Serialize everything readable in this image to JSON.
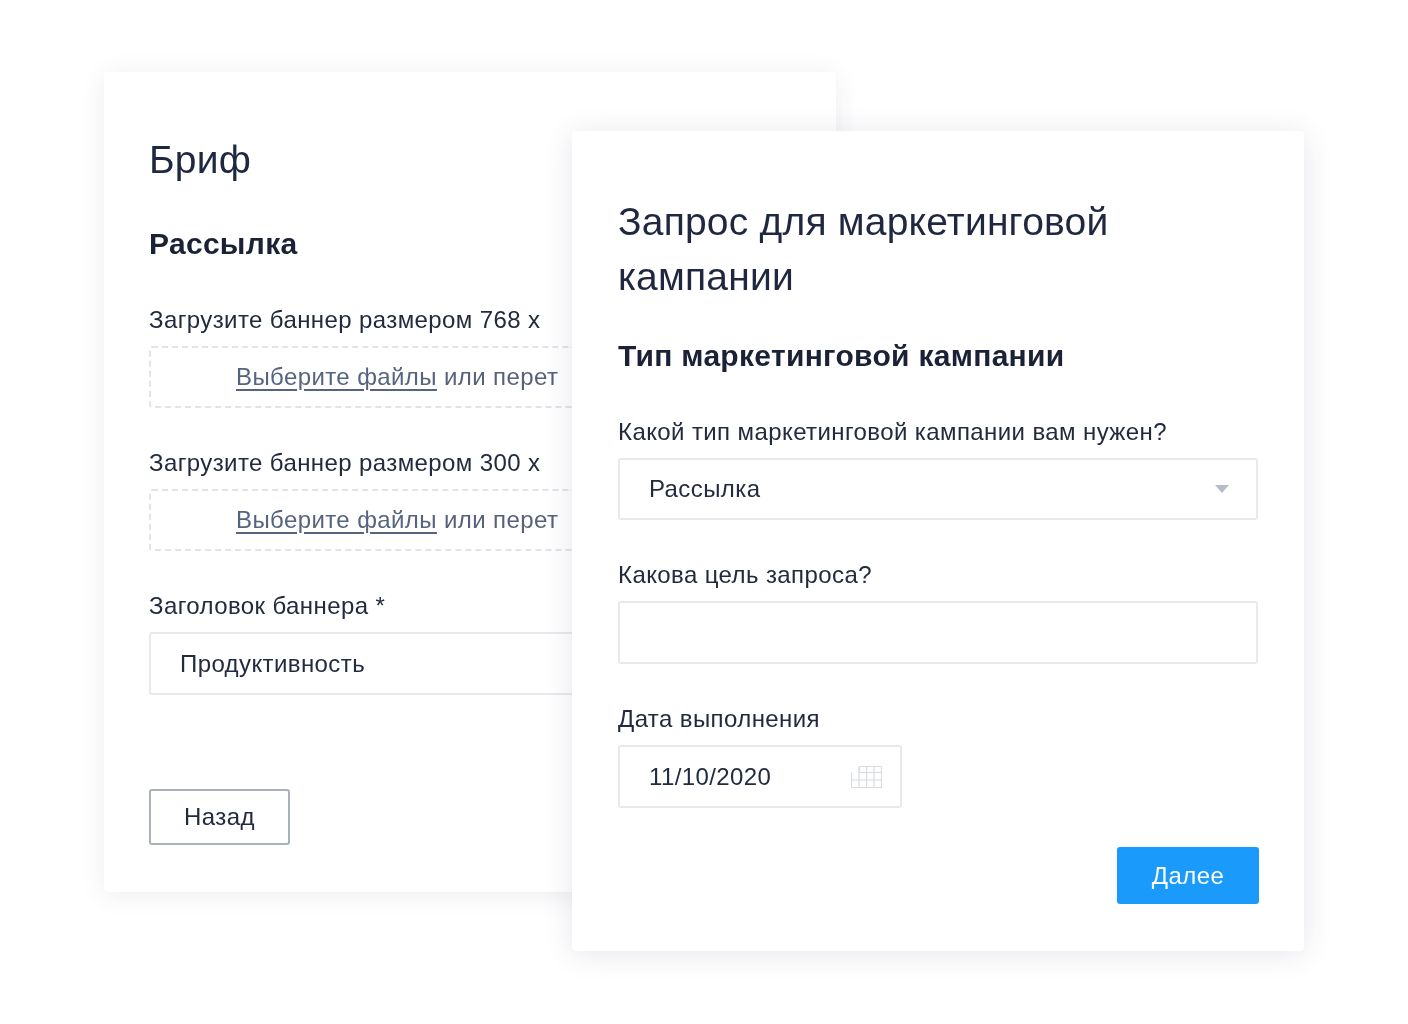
{
  "brief_card": {
    "title": "Бриф",
    "section": "Рассылка",
    "uploads": [
      {
        "label": "Загрузите баннер размером 768 x",
        "link": "Выберите файлы",
        "hint": "или перет"
      },
      {
        "label": "Загрузите баннер размером 300 x",
        "link": "Выберите файлы",
        "hint": "или перет"
      }
    ],
    "headline_field": {
      "label": "Заголовок баннера *",
      "value": "Продуктивность"
    },
    "back_button": "Назад"
  },
  "request_card": {
    "title": "Запрос для маркетинговой кампании",
    "section": "Тип маркетинговой кампании",
    "fields": [
      {
        "kind": "select",
        "label": "Какой тип маркетинговой кампании вам нужен?",
        "value": "Рассылка"
      },
      {
        "kind": "text",
        "label": "Какова цель запроса?"
      },
      {
        "kind": "date",
        "label": "Дата выполнения",
        "value": "11/10/2020"
      }
    ],
    "next_button": "Далее"
  }
}
